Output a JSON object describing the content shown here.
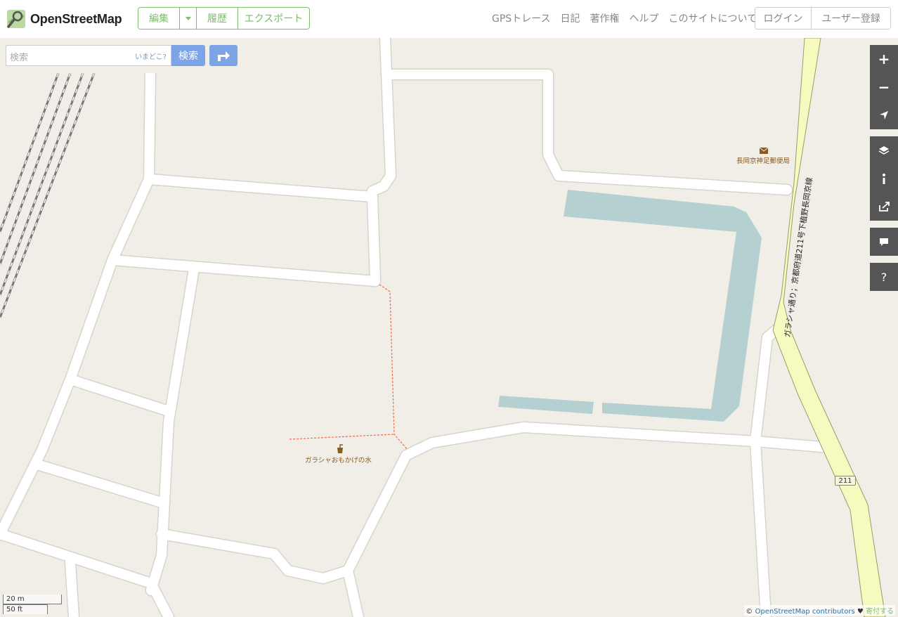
{
  "header": {
    "logo_text": "OpenStreetMap",
    "edit_label": "編集",
    "history_label": "履歴",
    "export_label": "エクスポート",
    "nav": [
      "GPSトレース",
      "日記",
      "著作権",
      "ヘルプ",
      "このサイトについて"
    ],
    "login_label": "ログイン",
    "signup_label": "ユーザー登録"
  },
  "search": {
    "placeholder": "検索",
    "where_label": "いまどこ?",
    "button_label": "検索"
  },
  "map": {
    "poi_post_office": "長岡京神足郵便局",
    "poi_water": "ガラシャおもかげの水",
    "route_name": "ガラシャ通り；京都府道211号下植野長岡京線",
    "route_shield": "211",
    "water_color": "#b5d0d0",
    "road_color": "#ffffff",
    "land_color": "#f1eee8",
    "highway_color": "#f7fabf"
  },
  "controls": {
    "zoom_in": "+",
    "zoom_out": "−",
    "help": "?"
  },
  "scale": {
    "metric": "20 m",
    "imperial": "50 ft"
  },
  "attribution": {
    "prefix": "©",
    "link": "OpenStreetMap contributors",
    "heart": "♥",
    "donate": "寄付する"
  }
}
